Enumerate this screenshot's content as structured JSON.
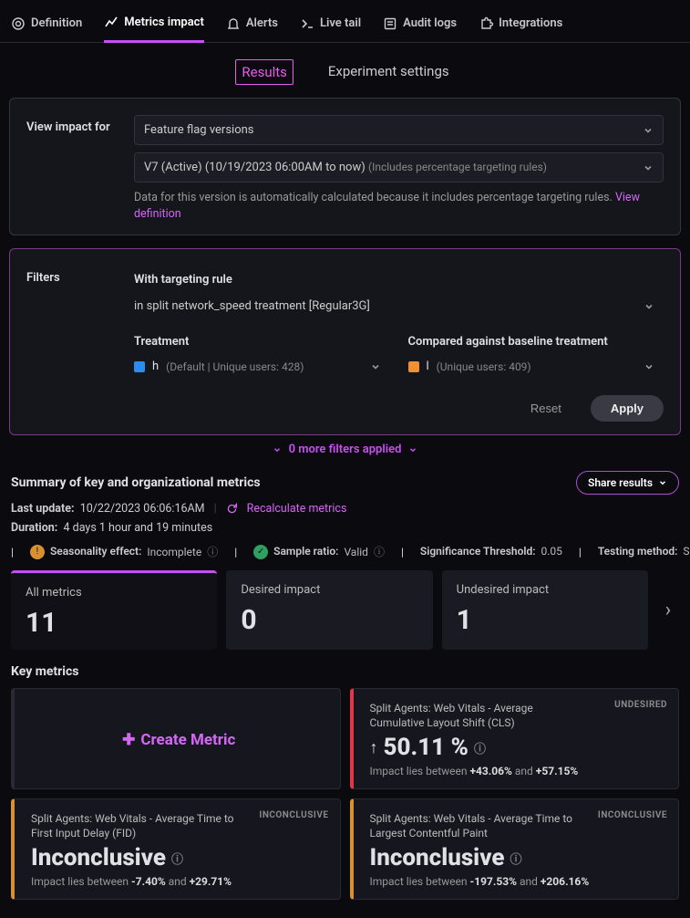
{
  "topnav": [
    {
      "label": "Definition",
      "icon": "target"
    },
    {
      "label": "Metrics impact",
      "icon": "chart",
      "active": true
    },
    {
      "label": "Alerts",
      "icon": "bell"
    },
    {
      "label": "Live tail",
      "icon": "terminal"
    },
    {
      "label": "Audit logs",
      "icon": "list"
    },
    {
      "label": "Integrations",
      "icon": "puzzle"
    }
  ],
  "subnav": [
    {
      "label": "Results",
      "active": true
    },
    {
      "label": "Experiment settings"
    }
  ],
  "view_impact": {
    "label": "View impact for",
    "select1": "Feature flag versions",
    "select2_main": "V7 (Active) (10/19/2023 06:00AM to now)",
    "select2_note": "(Includes percentage targeting rules)",
    "hint": "Data for this version is automatically calculated because it includes percentage targeting rules.",
    "hint_link": "View definition"
  },
  "filters": {
    "label": "Filters",
    "rule_label": "With targeting rule",
    "rule_value": "in split network_speed treatment [Regular3G]",
    "treatment_label": "Treatment",
    "treatment_value_name": "h",
    "treatment_value_meta": "(Default | Unique users: 428)",
    "baseline_label": "Compared against baseline treatment",
    "baseline_value_name": "l",
    "baseline_value_meta": "(Unique users: 409)",
    "reset": "Reset",
    "apply": "Apply"
  },
  "more_filters": "0 more filters applied",
  "summary": {
    "title": "Summary of key and organizational metrics",
    "share": "Share results",
    "last_update_label": "Last update:",
    "last_update_value": "10/22/2023 06:06:16AM",
    "recalc_icon": "refresh",
    "recalc": "Recalculate metrics",
    "duration_label": "Duration:",
    "duration_value": "4 days 1 hour and 19 minutes",
    "chips": [
      {
        "status": "warn",
        "label": "Seasonality effect:",
        "value": "Incomplete",
        "info": true
      },
      {
        "status": "ok",
        "label": "Sample ratio:",
        "value": "Valid",
        "info": true
      },
      {
        "label": "Significance Threshold:",
        "value": "0.05"
      },
      {
        "label": "Testing method:",
        "value": "Sequential testing"
      }
    ]
  },
  "tabs": [
    {
      "label": "All metrics",
      "value": "11",
      "active": true
    },
    {
      "label": "Desired impact",
      "value": "0"
    },
    {
      "label": "Undesired impact",
      "value": "1"
    }
  ],
  "key_metrics_title": "Key metrics",
  "cards": {
    "create": "Create Metric",
    "c1": {
      "title": "Split Agents: Web Vitals - Average Cumulative Layout Shift (CLS)",
      "badge": "UNDESIRED",
      "arrow": "↑",
      "value": "50.11 %",
      "range_pre": "Impact lies between ",
      "range_a": "+43.06%",
      "range_mid": " and ",
      "range_b": "+57.15%"
    },
    "c2": {
      "title": "Split Agents: Web Vitals - Average Time to First Input Delay (FID)",
      "badge": "INCONCLUSIVE",
      "value": "Inconclusive",
      "range_pre": "Impact lies between ",
      "range_a": "-7.40%",
      "range_mid": " and ",
      "range_b": "+29.71%"
    },
    "c3": {
      "title": "Split Agents: Web Vitals - Average Time to Largest Contentful Paint",
      "badge": "INCONCLUSIVE",
      "value": "Inconclusive",
      "range_pre": "Impact lies between ",
      "range_a": "-197.53%",
      "range_mid": " and ",
      "range_b": "+206.16%"
    }
  }
}
